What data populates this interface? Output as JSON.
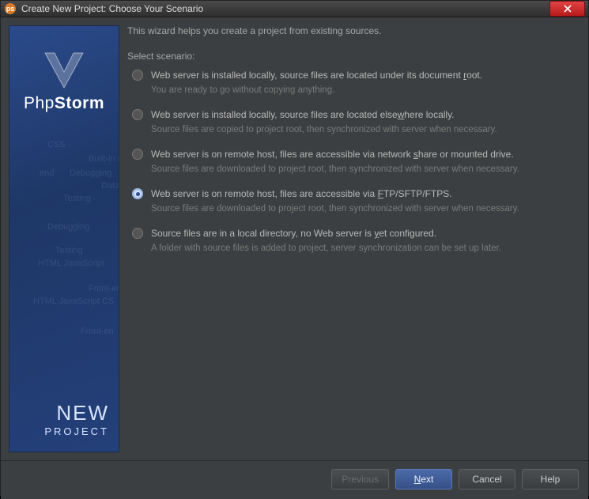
{
  "titlebar": {
    "title": "Create New Project: Choose Your Scenario"
  },
  "sidebar": {
    "brand_pre": "Php",
    "brand_bold": "Storm",
    "new": "NEW",
    "project": "PROJECT",
    "decor": [
      "CSS",
      "Built-in to",
      "end",
      "Debugging",
      "Data",
      "Testing",
      "Debugging",
      "Testing",
      "HTML  JavaScript",
      "Front-en",
      "HTML  JavaScript  CS",
      "Front-en"
    ]
  },
  "main": {
    "intro": "This wizard helps you create a project from existing sources.",
    "select_label": "Select scenario:",
    "options": [
      {
        "label_pre": "Web server is installed locally, source files are located under its document ",
        "label_u": "r",
        "label_post": "oot.",
        "desc": "You are ready to go without copying anything.",
        "selected": false
      },
      {
        "label_pre": "Web server is installed locally, source files are located else",
        "label_u": "w",
        "label_post": "here locally.",
        "desc": "Source files are copied to project root, then synchronized with server when necessary.",
        "selected": false
      },
      {
        "label_pre": "Web server is on remote host, files are accessible via network ",
        "label_u": "s",
        "label_post": "hare or mounted drive.",
        "desc": "Source files are downloaded to project root, then synchronized with server when necessary.",
        "selected": false
      },
      {
        "label_pre": "Web server is on remote host, files are accessible via ",
        "label_u": "F",
        "label_post": "TP/SFTP/FTPS.",
        "desc": "Source files are downloaded to project root, then synchronized with server when necessary.",
        "selected": true
      },
      {
        "label_pre": "Source files are in a local directory, no Web server is ",
        "label_u": "y",
        "label_post": "et configured.",
        "desc": "A folder with source files is added to project, server synchronization can be set up later.",
        "selected": false
      }
    ]
  },
  "footer": {
    "previous": "Previous",
    "next_u": "N",
    "next_rest": "ext",
    "cancel": "Cancel",
    "help": "Help"
  }
}
